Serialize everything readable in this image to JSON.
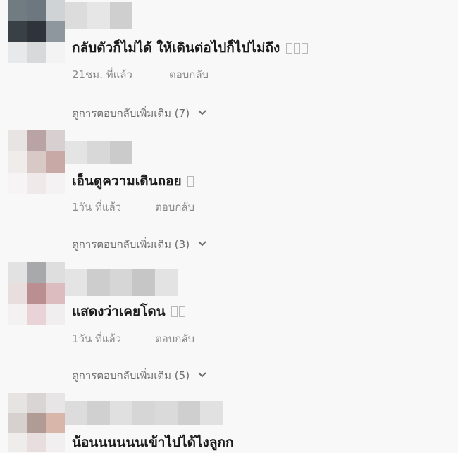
{
  "colors": {
    "background": "#f8f8f8",
    "text": "#1c1c1c",
    "meta": "#8a8a8a",
    "more_link": "#6b6b6b"
  },
  "comments": [
    {
      "text": "กลับตัวก็ไม่ได้ ให้เดินต่อไปก็ไปไม่ถึง",
      "emoji_boxes": 3,
      "time": "21ชม. ที่แล้ว",
      "reply": "ตอบกลับ",
      "more_replies": "ดูการตอบกลับเพิ่มเติม (7)"
    },
    {
      "text": "เอ็นดูความเดินถอย",
      "emoji_boxes": 1,
      "time": "1วัน ที่แล้ว",
      "reply": "ตอบกลับ",
      "more_replies": "ดูการตอบกลับเพิ่มเติม (3)"
    },
    {
      "text": "แสดงว่าเคยโดน",
      "emoji_boxes": 2,
      "time": "1วัน ที่แล้ว",
      "reply": "ตอบกลับ",
      "more_replies": "ดูการตอบกลับเพิ่มเติม (5)"
    },
    {
      "text": "น้อนนนนนนเข้าไปได้ไงลูกก"
    }
  ]
}
